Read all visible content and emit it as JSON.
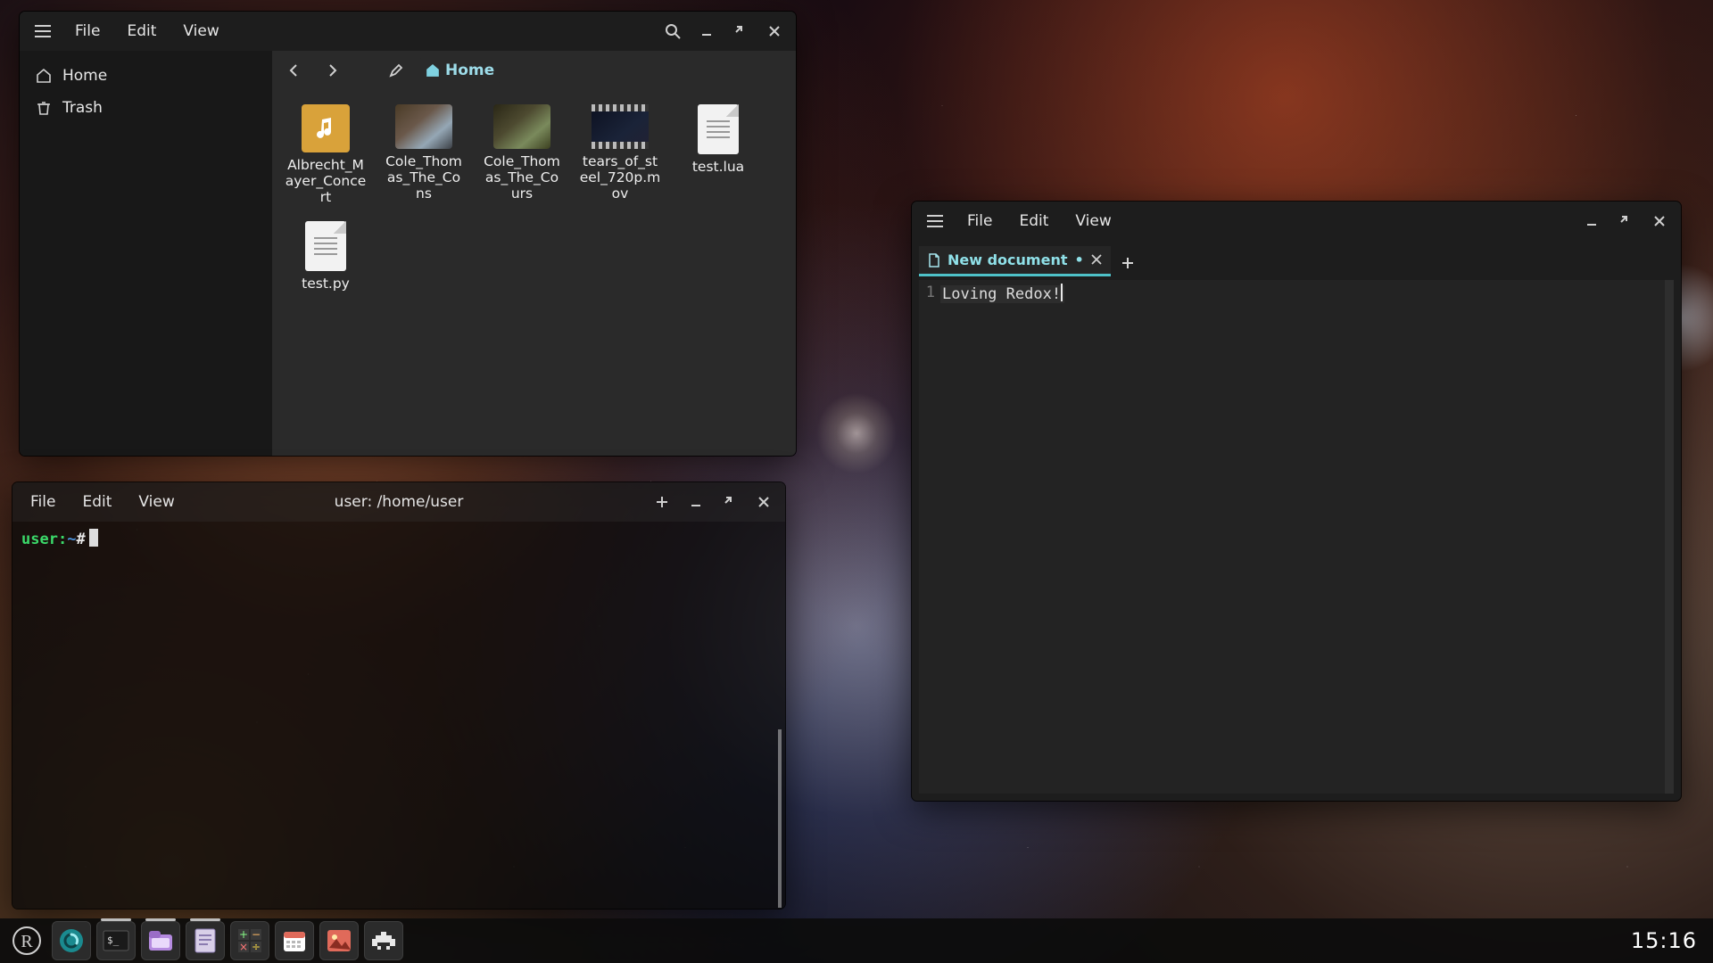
{
  "file_manager": {
    "menu": {
      "file": "File",
      "edit": "Edit",
      "view": "View"
    },
    "location_label": "Home",
    "sidebar": {
      "home": "Home",
      "trash": "Trash"
    },
    "files": [
      "Albrecht_Mayer_Concert",
      "Cole_Thomas_The_Cons",
      "Cole_Thomas_The_Cours",
      "tears_of_steel_720p.mov",
      "test.lua",
      "test.py"
    ]
  },
  "terminal": {
    "menu": {
      "file": "File",
      "edit": "Edit",
      "view": "View"
    },
    "title": "user: /home/user",
    "prompt_user": "user:",
    "prompt_path": "~",
    "prompt_symbol": "#"
  },
  "editor": {
    "menu": {
      "file": "File",
      "edit": "Edit",
      "view": "View"
    },
    "tab": {
      "title": "New document",
      "modified_indicator": "•"
    },
    "line_number": "1",
    "content": "Loving Redox!"
  },
  "taskbar": {
    "clock": "15:16"
  }
}
